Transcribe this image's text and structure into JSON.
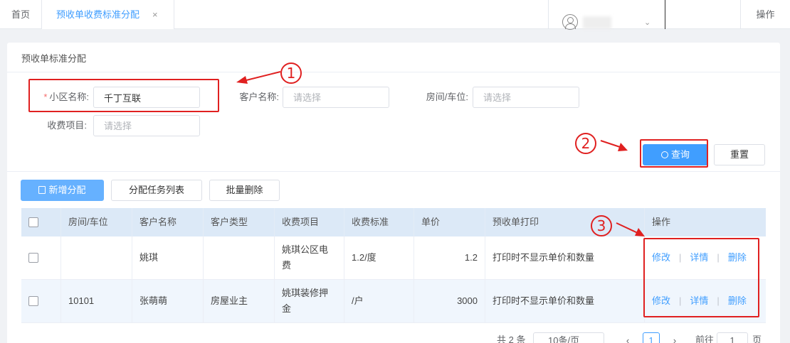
{
  "tabs": {
    "home": "首页",
    "active": "预收单收费标准分配",
    "close": "×"
  },
  "header": {
    "ops": "操作",
    "caret": "⌄"
  },
  "panel": {
    "title": "预收单标准分配"
  },
  "form": {
    "required_mark": "*",
    "community_label": "小区名称:",
    "community_value": "千丁互联",
    "customer_label": "客户名称:",
    "customer_placeholder": "请选择",
    "room_label": "房间/车位:",
    "room_placeholder": "请选择",
    "fee_label": "收费项目:",
    "fee_placeholder": "请选择"
  },
  "actions": {
    "query": "查询",
    "reset": "重置"
  },
  "toolbar": {
    "add": "新增分配",
    "task_list": "分配任务列表",
    "batch_delete": "批量删除"
  },
  "annotations": {
    "n1": "1",
    "n2": "2",
    "n3": "3",
    "color": "#e02020"
  },
  "table": {
    "headers": [
      "房间/车位",
      "客户名称",
      "客户类型",
      "收费项目",
      "收费标准",
      "单价",
      "预收单打印",
      "操作"
    ],
    "rows": [
      {
        "room": "",
        "customer": "姚琪",
        "type": "",
        "fee_item": "姚琪公区电费",
        "standard": "1.2/度",
        "price": "1.2",
        "print": "打印时不显示单价和数量",
        "edit": "修改",
        "detail": "详情",
        "delete": "删除"
      },
      {
        "room": "10101",
        "customer": "张萌萌",
        "type": "房屋业主",
        "fee_item": "姚琪装修押金",
        "standard": "/户",
        "price": "3000",
        "print": "打印时不显示单价和数量",
        "edit": "修改",
        "detail": "详情",
        "delete": "删除"
      }
    ]
  },
  "pagination": {
    "total": "共 2 条",
    "page_size": "10条/页",
    "current": "1",
    "goto": "前往",
    "goto_value": "1",
    "page_unit": "页"
  },
  "colors": {
    "primary": "#409eff",
    "header_bg": "#dce9f7",
    "row_alt": "#f0f6fd"
  }
}
